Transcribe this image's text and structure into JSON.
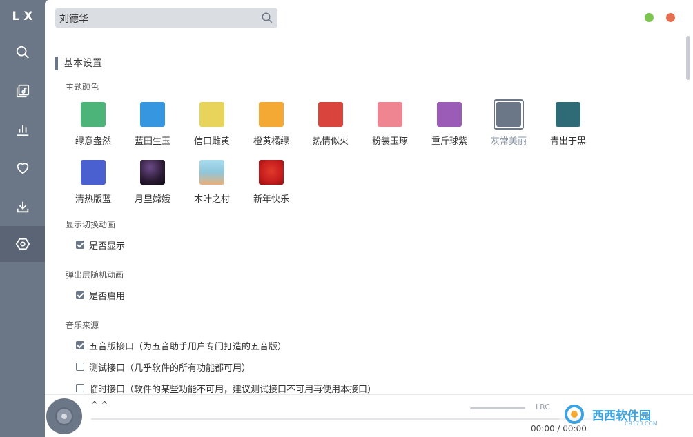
{
  "app": {
    "logo": "LX"
  },
  "nav": [
    {
      "name": "search-icon"
    },
    {
      "name": "song-list-icon"
    },
    {
      "name": "leaderboard-icon"
    },
    {
      "name": "favorite-icon"
    },
    {
      "name": "download-icon"
    },
    {
      "name": "settings-icon",
      "active": true
    }
  ],
  "search": {
    "value": "刘德华"
  },
  "settings": {
    "section_title": "基本设置",
    "theme_label": "主题颜色",
    "themes": [
      {
        "name": "绿意盎然",
        "color": "#4db479"
      },
      {
        "name": "蓝田生玉",
        "color": "#3796e0"
      },
      {
        "name": "信口雌黄",
        "color": "#e9d45b"
      },
      {
        "name": "橙黄橘绿",
        "color": "#f5a935"
      },
      {
        "name": "热情似火",
        "color": "#d9443c"
      },
      {
        "name": "粉装玉琢",
        "color": "#ef8591"
      },
      {
        "name": "重斤球紫",
        "color": "#9b5cb8"
      },
      {
        "name": "灰常美丽",
        "color": "#6b7686",
        "selected": true
      },
      {
        "name": "青出于黑",
        "color": "#2e6b77"
      },
      {
        "name": "清热版蓝",
        "color": "#4a5fd0"
      },
      {
        "name": "月里嫦娥",
        "color": "#2a1a33"
      },
      {
        "name": "木叶之村",
        "color": "#8fc6da"
      },
      {
        "name": "新年快乐",
        "color": "#c41d1d"
      }
    ],
    "animation_label": "显示切换动画",
    "animation_option": "是否显示",
    "popup_label": "弹出层随机动画",
    "popup_option": "是否启用",
    "source_label": "音乐来源",
    "sources": [
      {
        "label": "五音版接口（为五音助手用户专门打造的五音版）",
        "checked": true
      },
      {
        "label": "测试接口（几乎软件的所有功能都可用）",
        "checked": false
      },
      {
        "label": "临时接口（软件的某些功能不可用，建议测试接口不可用再使用本接口）",
        "checked": false
      }
    ]
  },
  "player": {
    "title": "^-^",
    "lrc": "LRC",
    "time": "00:00 / 00:00"
  },
  "watermark": {
    "text": "西西软件园",
    "sub": "CR173.COM"
  }
}
